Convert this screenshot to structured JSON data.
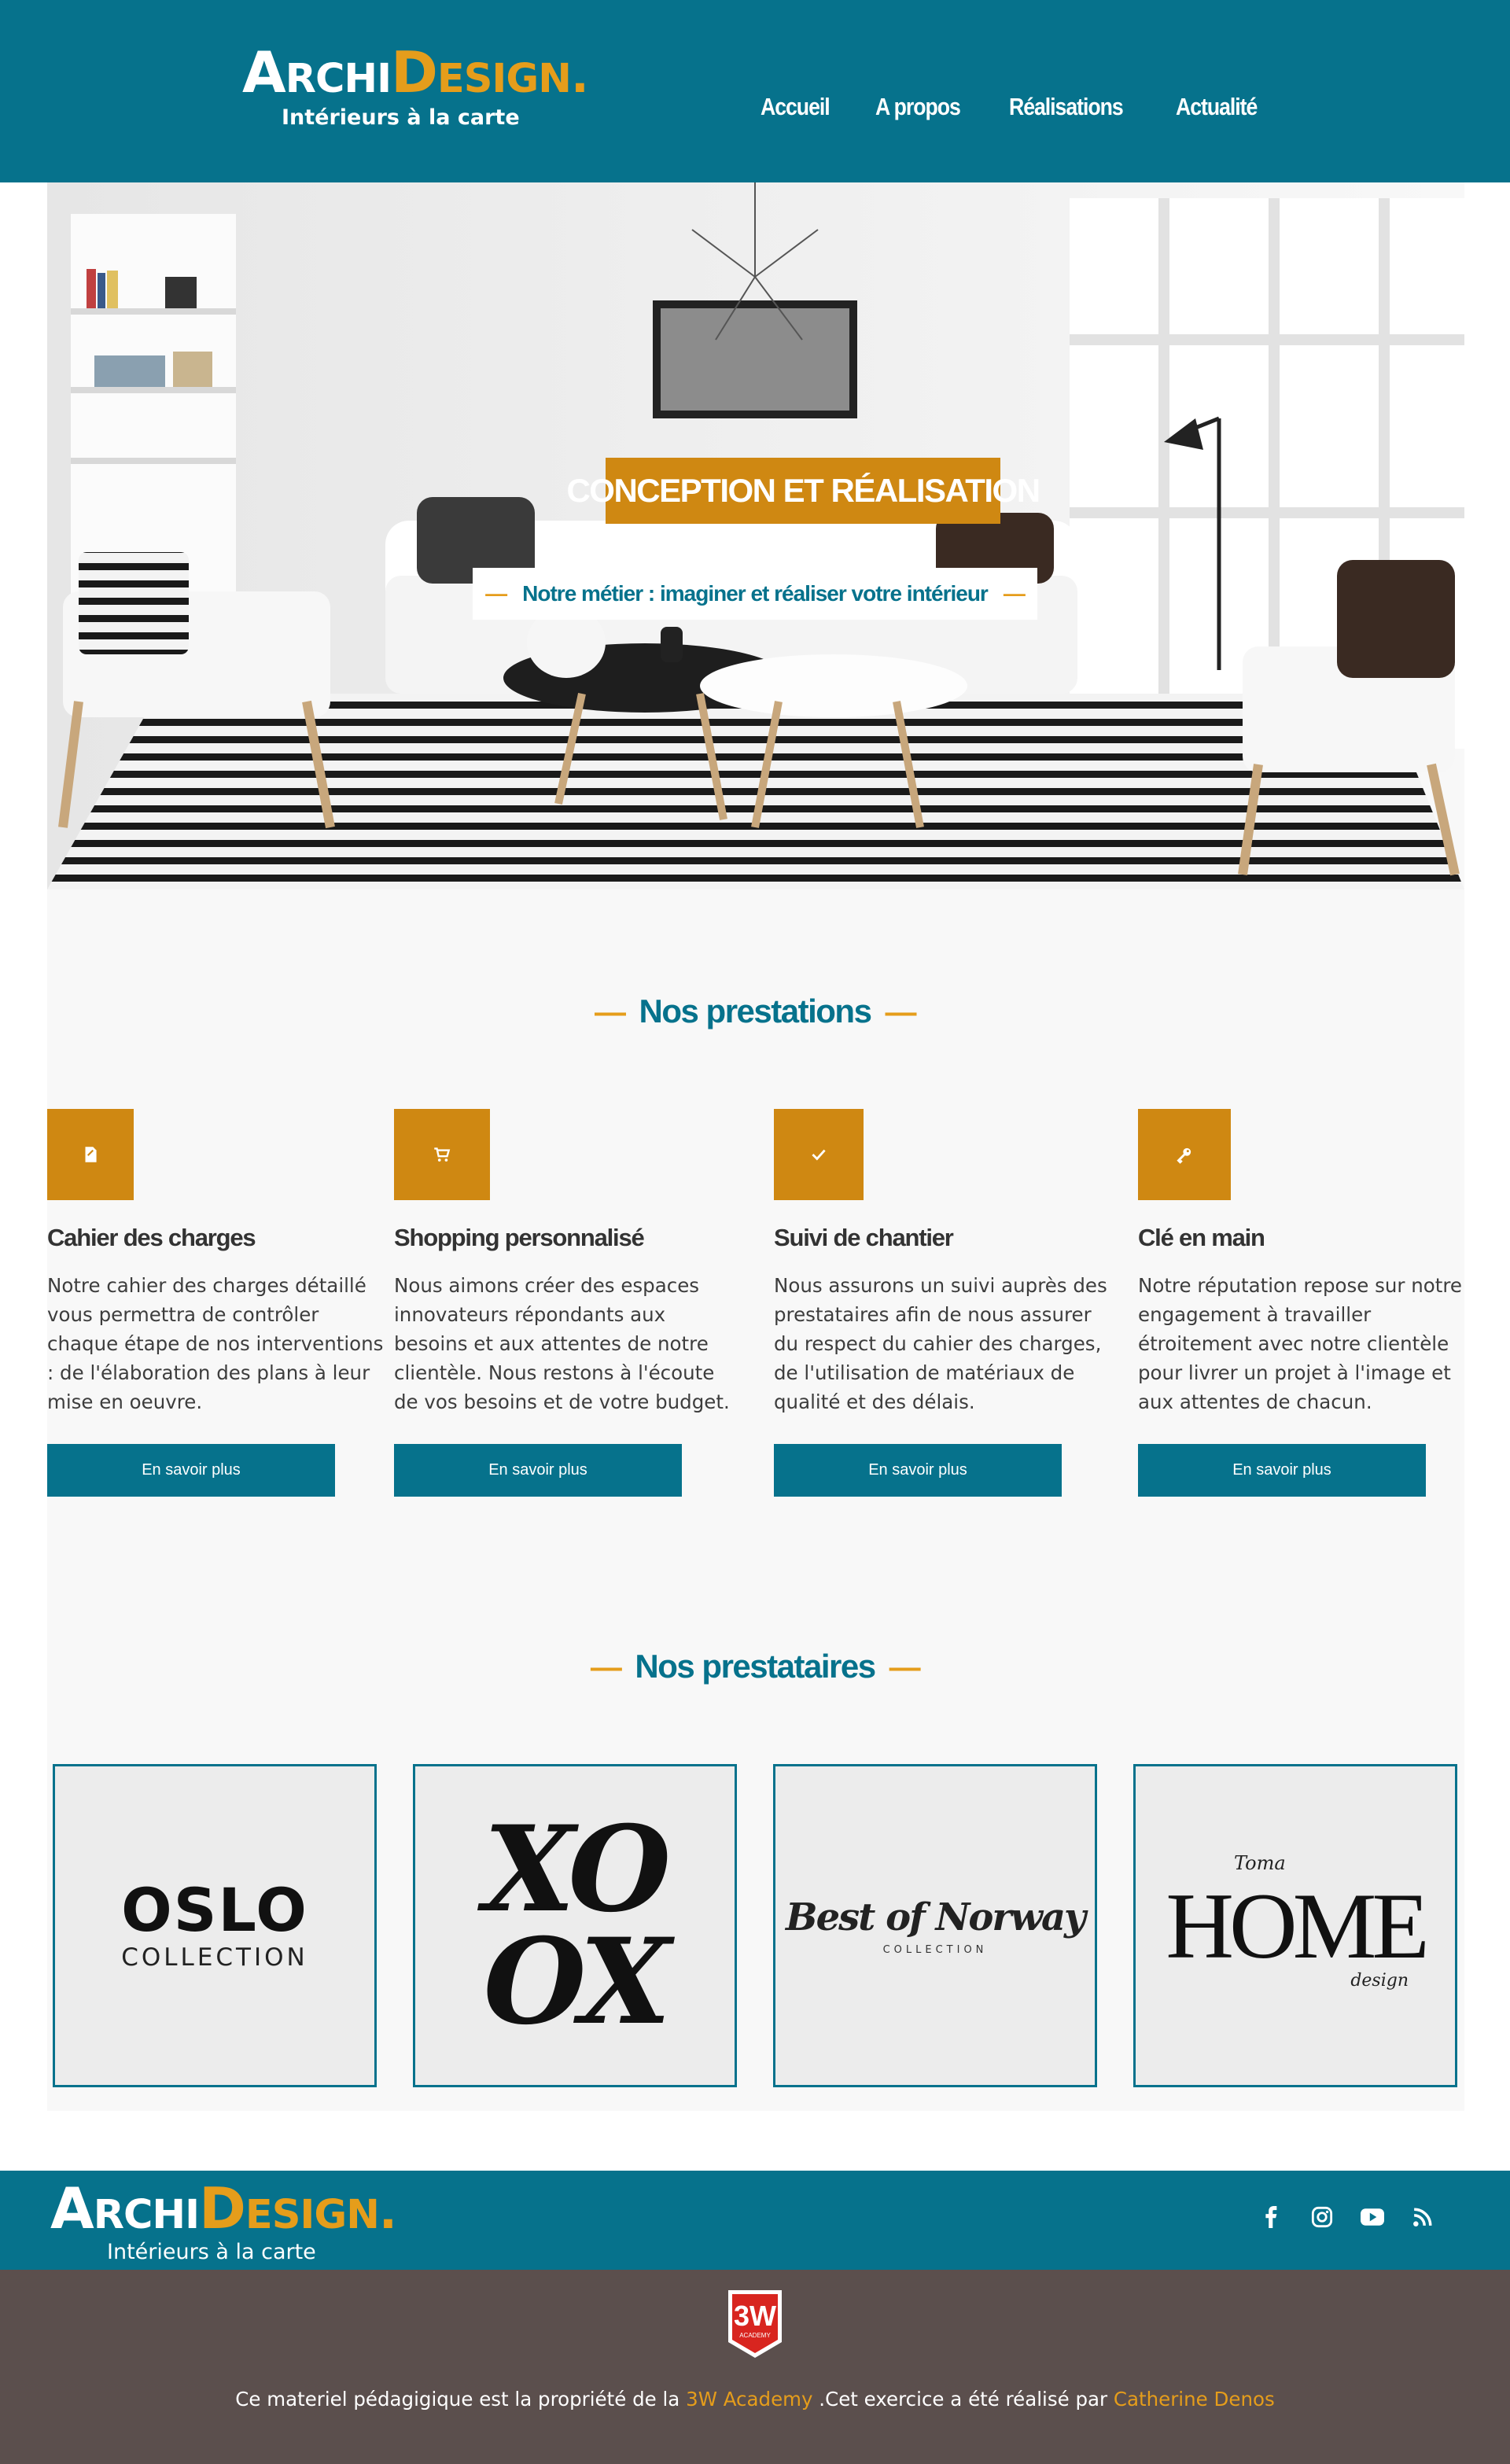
{
  "brand": {
    "name_part1": "Archi",
    "name_part2": "Design",
    "dot": ".",
    "tagline": "Intérieurs à la carte"
  },
  "nav": {
    "items": [
      {
        "label": "Accueil"
      },
      {
        "label": "A propos"
      },
      {
        "label": "Réalisations"
      },
      {
        "label": "Actualité"
      }
    ]
  },
  "hero": {
    "title": "CONCEPTION ET RÉALISATION",
    "subtitle": "Notre métier : imaginer et réaliser votre intérieur",
    "dash": "—"
  },
  "services": {
    "title": "Nos prestations",
    "items": [
      {
        "icon": "document-icon",
        "title": "Cahier des charges",
        "text": "Notre cahier des charges détaillé vous permettra de contrôler chaque étape de nos interventions : de l'élaboration des plans à leur mise en oeuvre.",
        "button": "En savoir plus"
      },
      {
        "icon": "cart-icon",
        "title": "Shopping personnalisé",
        "text": "Nous aimons créer des espaces innovateurs répondants aux besoins et aux attentes de notre clientèle. Nous restons à l'écoute de vos besoins et de votre budget.",
        "button": "En savoir plus"
      },
      {
        "icon": "checkmark-icon",
        "title": "Suivi de chantier",
        "text": "Nous assurons un suivi auprès des prestataires afin de nous assurer du respect du cahier des charges, de l'utilisation de matériaux de qualité et des délais.",
        "button": "En savoir plus"
      },
      {
        "icon": "key-icon",
        "title": "Clé en main",
        "text": "Notre réputation repose sur notre engagement à travailler étroitement avec notre clientèle pour livrer un projet à l'image et aux attentes de chacun.",
        "button": "En savoir plus"
      }
    ]
  },
  "partners": {
    "title": "Nos prestataires",
    "items": [
      {
        "name": "OSLO",
        "sub": "COLLECTION"
      },
      {
        "name_line1": "XO",
        "name_line2": "OX"
      },
      {
        "name": "Best of Norway",
        "sub": "COLLECTION"
      },
      {
        "small": "Toma",
        "name": "HOME",
        "script": "design"
      }
    ]
  },
  "footer": {
    "socials": [
      "facebook-icon",
      "instagram-icon",
      "youtube-icon",
      "rss-icon"
    ],
    "academy_logo": {
      "big": "3W",
      "small": "ACADEMY"
    },
    "credit_prefix": "Ce materiel pédagigique est la propriété de la ",
    "credit_link1": "3W Academy",
    "credit_middle": " .Cet exercice a été réalisé par ",
    "credit_link2": "Catherine Denos"
  },
  "colors": {
    "primary": "#06728c",
    "accent": "#cf8812",
    "footer_dark": "#5b4f4d"
  }
}
